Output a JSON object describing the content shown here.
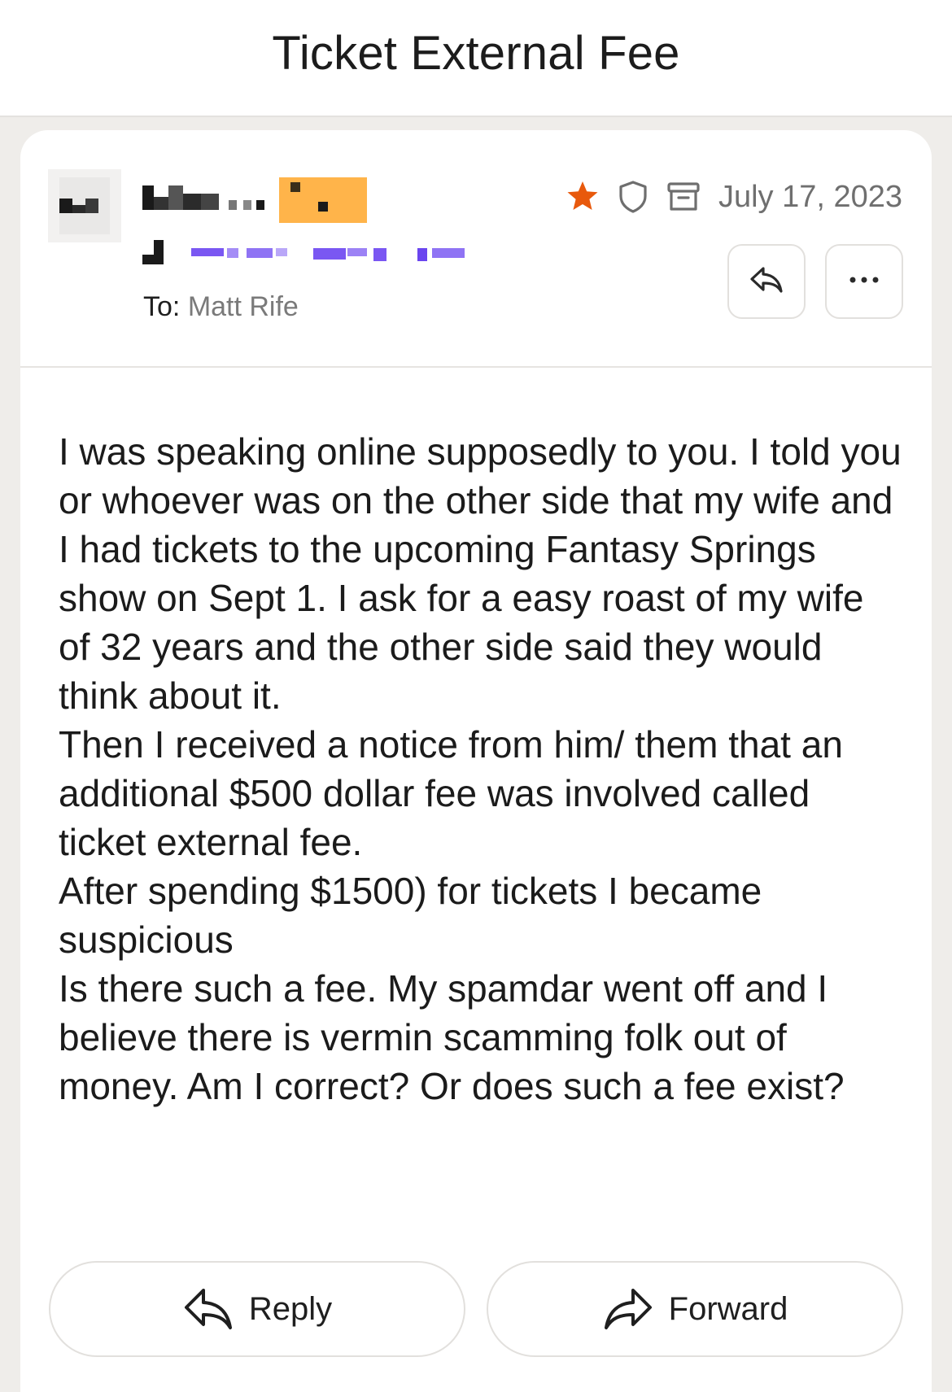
{
  "header": {
    "subject": "Ticket External Fee"
  },
  "message": {
    "recipient_label": "To:",
    "recipient_name": "Matt Rife",
    "date": "July 17, 2023",
    "body_paragraphs": [
      "I was speaking online supposedly to you. I told you or whoever was on the other side that my wife and I had tickets to the upcoming Fantasy Springs show on Sept 1. I ask for a easy roast of my wife of 32 years and the other side said they would think about it.",
      "Then I received a notice from him/ them that an additional $500 dollar fee was involved called ticket external fee.",
      "After spending $1500) for tickets I became suspicious",
      "Is there such a fee. My spamdar went off and I believe there is vermin scamming folk out of money. Am I correct? Or does such a fee exist?"
    ]
  },
  "actions": {
    "reply_label": "Reply",
    "forward_label": "Forward"
  },
  "icons": {
    "star": "star-icon",
    "shield": "shield-icon",
    "archive": "archive-icon",
    "reply": "reply-icon",
    "more": "more-icon",
    "forward": "forward-icon"
  },
  "colors": {
    "star": "#e8590c",
    "redaction_orange": "#ffb44a",
    "redaction_purple": "#7a57f2",
    "page_background": "#efedea"
  }
}
